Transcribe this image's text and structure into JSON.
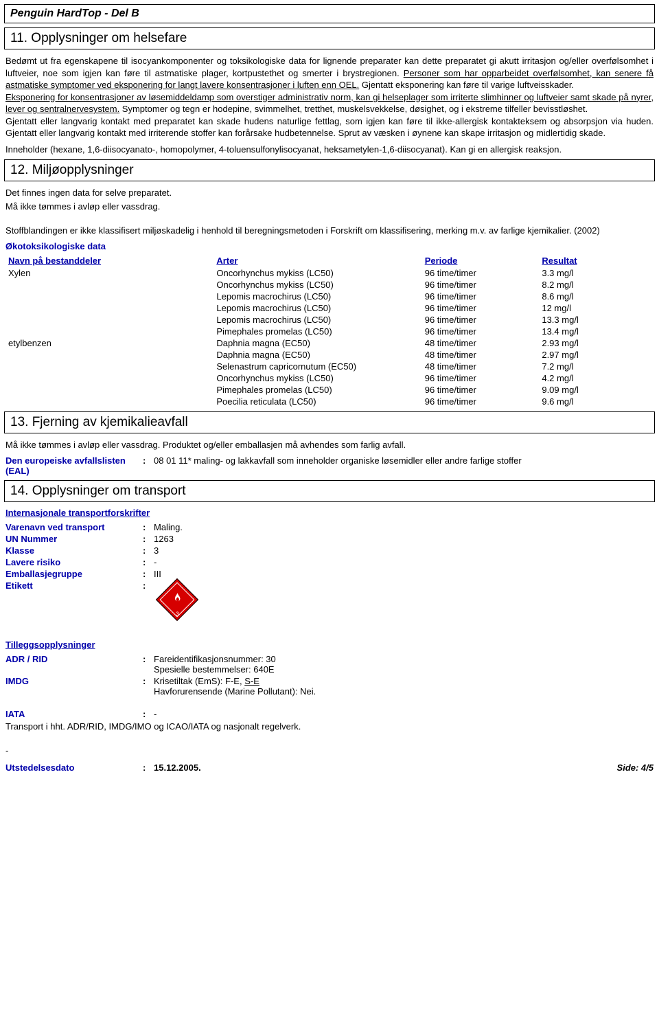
{
  "doc": {
    "title": "Penguin HardTop - Del B"
  },
  "s11": {
    "num": "11.",
    "heading": "Opplysninger om helsefare",
    "p1": "Bedømt ut fra egenskapene til isocyankomponenter og toksikologiske data for lignende preparater kan dette preparatet gi akutt irritasjon og/eller overfølsomhet i luftveier, noe som igjen kan føre til astmatiske plager, kortpustethet og smerter i brystregionen. ",
    "p1u": "Personer som har opparbeidet overfølsomhet, kan senere få astmatiske symptomer ved eksponering for langt lavere konsentrasjoner i luften enn OEL.",
    "p1b": " Gjentatt eksponering kan føre til varige luftveisskader.",
    "p2u": "Eksponering for konsentrasjoner av løsemiddeldamp som overstiger administrativ norm, kan gi helseplager som irriterte slimhinner og luftveier samt skade på nyrer, lever og sentralnervesystem.",
    "p2b": " Symptomer og tegn er hodepine, svimmelhet, tretthet, muskelsvekkelse, døsighet, og i ekstreme tilfeller bevisstløshet.",
    "p3": "Gjentatt eller langvarig kontakt med preparatet kan skade hudens naturlige fettlag, som igjen kan føre til ikke-allergisk kontakteksem og absorpsjon via huden. Gjentatt eller langvarig kontakt med irriterende stoffer kan forårsake hudbetennelse. Sprut av væsken i øynene kan skape irritasjon og midlertidig skade.",
    "p4": "Inneholder (hexane, 1,6-diisocyanato-, homopolymer, 4-toluensulfonylisocyanat, heksametylen-1,6-diisocyanat). Kan gi en allergisk reaksjon."
  },
  "s12": {
    "num": "12.",
    "heading": "Miljøopplysninger",
    "p1": "Det finnes ingen data for selve preparatet.",
    "p2": "Må ikke tømmes i avløp eller vassdrag.",
    "p3": "Stoffblandingen er ikke klassifisert miljøskadelig i henhold til beregningsmetoden i Forskrift om klassifisering, merking m.v. av farlige kjemikalier. (2002)",
    "eco_title": "Økotoksikologiske data",
    "headers": {
      "name": "Navn på bestanddeler",
      "arter": "Arter",
      "periode": "Periode",
      "resultat": "Resultat"
    },
    "rows": [
      {
        "name": "Xylen",
        "arter": "Oncorhynchus mykiss (LC50)",
        "periode": "96 time/timer",
        "resultat": "3.3 mg/l"
      },
      {
        "name": "",
        "arter": "Oncorhynchus mykiss (LC50)",
        "periode": "96 time/timer",
        "resultat": "8.2 mg/l"
      },
      {
        "name": "",
        "arter": "Lepomis macrochirus (LC50)",
        "periode": "96 time/timer",
        "resultat": "8.6 mg/l"
      },
      {
        "name": "",
        "arter": "Lepomis macrochirus (LC50)",
        "periode": "96 time/timer",
        "resultat": "12 mg/l"
      },
      {
        "name": "",
        "arter": "Lepomis macrochirus (LC50)",
        "periode": "96 time/timer",
        "resultat": "13.3 mg/l"
      },
      {
        "name": "",
        "arter": "Pimephales promelas (LC50)",
        "periode": "96 time/timer",
        "resultat": "13.4 mg/l"
      },
      {
        "name": "etylbenzen",
        "arter": "Daphnia magna (EC50)",
        "periode": "48 time/timer",
        "resultat": "2.93 mg/l"
      },
      {
        "name": "",
        "arter": "Daphnia magna (EC50)",
        "periode": "48 time/timer",
        "resultat": "2.97 mg/l"
      },
      {
        "name": "",
        "arter": "Selenastrum capricornutum (EC50)",
        "periode": "48 time/timer",
        "resultat": "7.2 mg/l"
      },
      {
        "name": "",
        "arter": "Oncorhynchus mykiss (LC50)",
        "periode": "96 time/timer",
        "resultat": "4.2 mg/l"
      },
      {
        "name": "",
        "arter": "Pimephales promelas (LC50)",
        "periode": "96 time/timer",
        "resultat": "9.09 mg/l"
      },
      {
        "name": "",
        "arter": "Poecilia reticulata (LC50)",
        "periode": "96 time/timer",
        "resultat": "9.6 mg/l"
      }
    ]
  },
  "s13": {
    "num": "13.",
    "heading": "Fjerning av kjemikalieavfall",
    "p1": "Må ikke tømmes i avløp eller vassdrag. Produktet og/eller emballasjen må avhendes som farlig avfall.",
    "eal_label": "Den europeiske avfallslisten (EAL)",
    "eal_value": "08 01 11* maling- og lakkavfall som inneholder organiske løsemidler eller andre farlige stoffer"
  },
  "s14": {
    "num": "14.",
    "heading": "Opplysninger om transport",
    "intl_title": "Internasjonale transportforskrifter",
    "rows": {
      "varenavn_label": "Varenavn ved transport",
      "varenavn_value": "Maling.",
      "un_label": "UN Nummer",
      "un_value": "1263",
      "klasse_label": "Klasse",
      "klasse_value": "3",
      "lavere_label": "Lavere risiko",
      "lavere_value": "-",
      "emb_label": "Emballasjegruppe",
      "emb_value": "III",
      "etikett_label": "Etikett",
      "hazard_class": "3"
    },
    "add_title": "Tilleggsopplysninger",
    "adr_label": "ADR / RID",
    "adr_line1": "Fareidentifikasjonsnummer: 30",
    "adr_line2": "Spesielle bestemmelser: 640E",
    "imdg_label": "IMDG",
    "imdg_line1a": "Krisetiltak (EmS): F-E, ",
    "imdg_line1b": "S-E",
    "imdg_line2": "Havforurensende (Marine Pollutant): Nei.",
    "iata_label": "IATA",
    "iata_value": "-",
    "transport_note": "Transport i hht. ADR/RID, IMDG/IMO og ICAO/IATA og nasjonalt regelverk.",
    "dash": "-"
  },
  "footer": {
    "label": "Utstedelsesdato",
    "colon": ":",
    "date": "15.12.2005.",
    "side": "Side: 4/5"
  }
}
